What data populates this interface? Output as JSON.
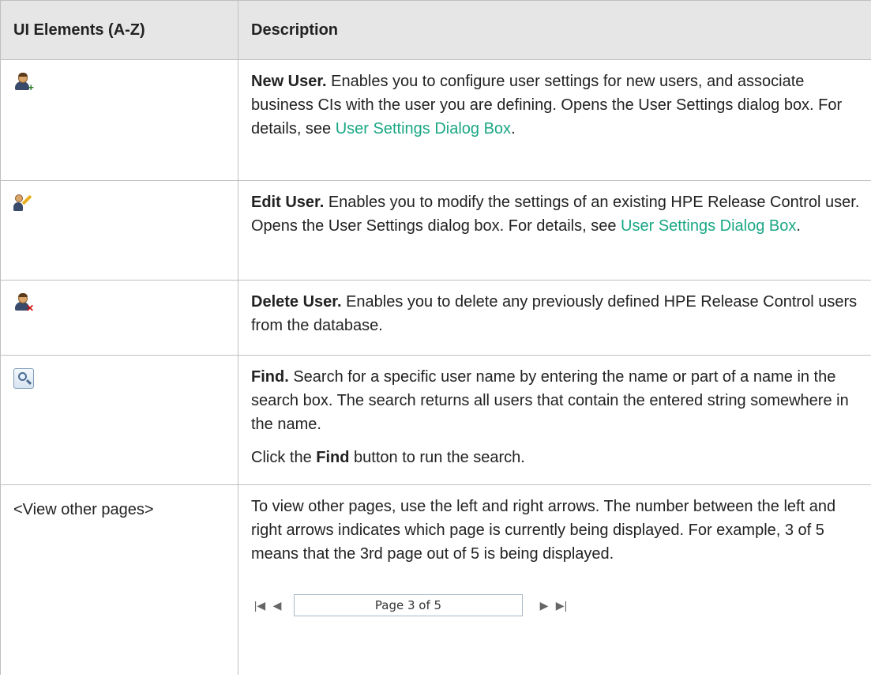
{
  "header": {
    "col1": "UI Elements (A-Z)",
    "col2": "Description"
  },
  "rows": [
    {
      "icon": "new-user-icon",
      "title": "New User.",
      "text": " Enables you to configure user settings for new users, and associate business CIs with the user you are defining. Opens the User Settings dialog box. For details, see ",
      "link": "User Settings Dialog Box",
      "tail": "."
    },
    {
      "icon": "edit-user-icon",
      "title": "Edit User.",
      "text": " Enables you to modify the settings of an existing HPE Release Control user. Opens the User Settings dialog box. For details, see ",
      "link": "User Settings Dialog Box",
      "tail": "."
    },
    {
      "icon": "delete-user-icon",
      "title": "Delete User.",
      "text": " Enables you to delete any previously defined HPE Release Control users from the database."
    },
    {
      "icon": "find-icon",
      "title": "Find.",
      "text": " Search for a specific user name by entering the name or part of a name in the search box. The search returns all users that contain the entered string somewhere in the name.",
      "p2_pre": "Click the ",
      "p2_bold": "Find",
      "p2_post": " button to run the search."
    },
    {
      "element": "<View other pages>",
      "text": "To view other pages, use the left and right arrows. The number between the left and right arrows indicates which page is currently being displayed. For example, 3 of 5 means that the 3rd page out of 5 is being displayed.",
      "pager": {
        "first": "|◀",
        "prev": "◀",
        "page_label": "Page 3 of 5",
        "next": "▶",
        "last": "▶|"
      }
    }
  ],
  "colors": {
    "link": "#1aa785",
    "header_bg": "#e6e6e6",
    "border": "#bfbfbf"
  }
}
